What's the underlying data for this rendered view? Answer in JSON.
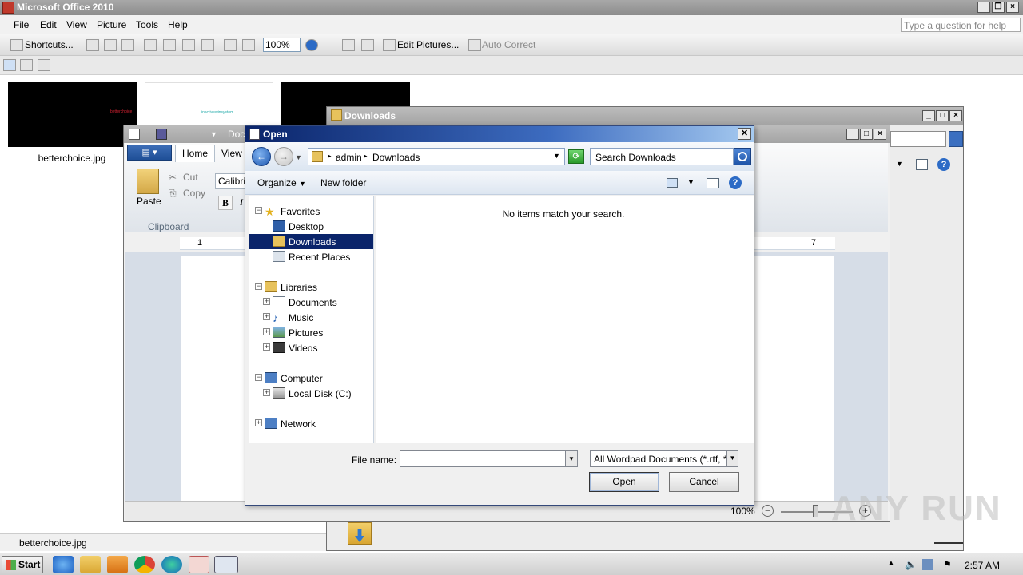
{
  "main_window": {
    "title": "Microsoft Office 2010",
    "menu": [
      "File",
      "Edit",
      "View",
      "Picture",
      "Tools",
      "Help"
    ],
    "help_placeholder": "Type a question for help",
    "toolbar": {
      "shortcuts_label": "Shortcuts...",
      "zoom_value": "100%",
      "edit_pictures_label": "Edit Pictures...",
      "auto_correct_label": "Auto Correct"
    },
    "thumbnails": [
      "betterchoice",
      "inactivewinsystem",
      ""
    ],
    "thumb_label": "betterchoice.jpg",
    "status_text": "betterchoice.jpg"
  },
  "explorer_window": {
    "title": "Downloads"
  },
  "wordpad": {
    "title": "Doc",
    "tabs": [
      "Home",
      "View"
    ],
    "clipboard": {
      "paste": "Paste",
      "cut": "Cut",
      "copy": "Copy",
      "group_label": "Clipboard"
    },
    "font_name": "Calibri",
    "bold": "B",
    "italic": "I",
    "ruler_left": "1",
    "ruler_right": "7",
    "zoom": "100%"
  },
  "open_dialog": {
    "title": "Open",
    "address": {
      "segments": [
        "admin",
        "Downloads"
      ]
    },
    "search_placeholder": "Search Downloads",
    "commands": {
      "organize": "Organize",
      "new_folder": "New folder"
    },
    "nav": {
      "favorites": "Favorites",
      "desktop": "Desktop",
      "downloads": "Downloads",
      "recent": "Recent Places",
      "libraries": "Libraries",
      "documents": "Documents",
      "music": "Music",
      "pictures": "Pictures",
      "videos": "Videos",
      "computer": "Computer",
      "local_disk": "Local Disk (C:)",
      "network": "Network"
    },
    "empty_message": "No items match your search.",
    "file_name_label": "File name:",
    "file_name_value": "",
    "file_type": "All Wordpad Documents (*.rtf, *",
    "open_label": "Open",
    "cancel_label": "Cancel"
  },
  "watermark": "ANY RUN",
  "taskbar": {
    "start": "Start",
    "clock": "2:57 AM"
  },
  "colors": {
    "selection": "#0a246a",
    "dialog_title_start": "#0a246a",
    "dialog_title_end": "#a6caf0"
  }
}
